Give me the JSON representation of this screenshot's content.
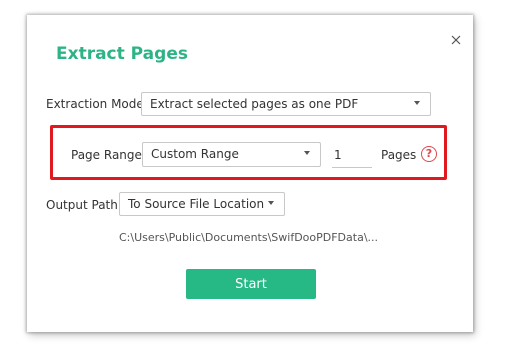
{
  "dialog": {
    "title": "Extract Pages",
    "close_icon": "close-icon"
  },
  "extraction_mode": {
    "label": "Extraction Mode:",
    "selected": "Extract selected pages as one PDF"
  },
  "page_range": {
    "label": "Page Range:",
    "selected": "Custom Range",
    "value": "1",
    "unit": "Pages",
    "help_icon": "help-icon",
    "help_glyph": "?",
    "highlight_color": "#e0191e"
  },
  "output_path": {
    "label": "Output Path:",
    "selected": "To Source File Location",
    "path": "C:\\Users\\Public\\Documents\\SwifDooPDFData\\..."
  },
  "start_button": {
    "label": "Start",
    "color": "#26b885"
  },
  "colors": {
    "title": "#2db386"
  }
}
